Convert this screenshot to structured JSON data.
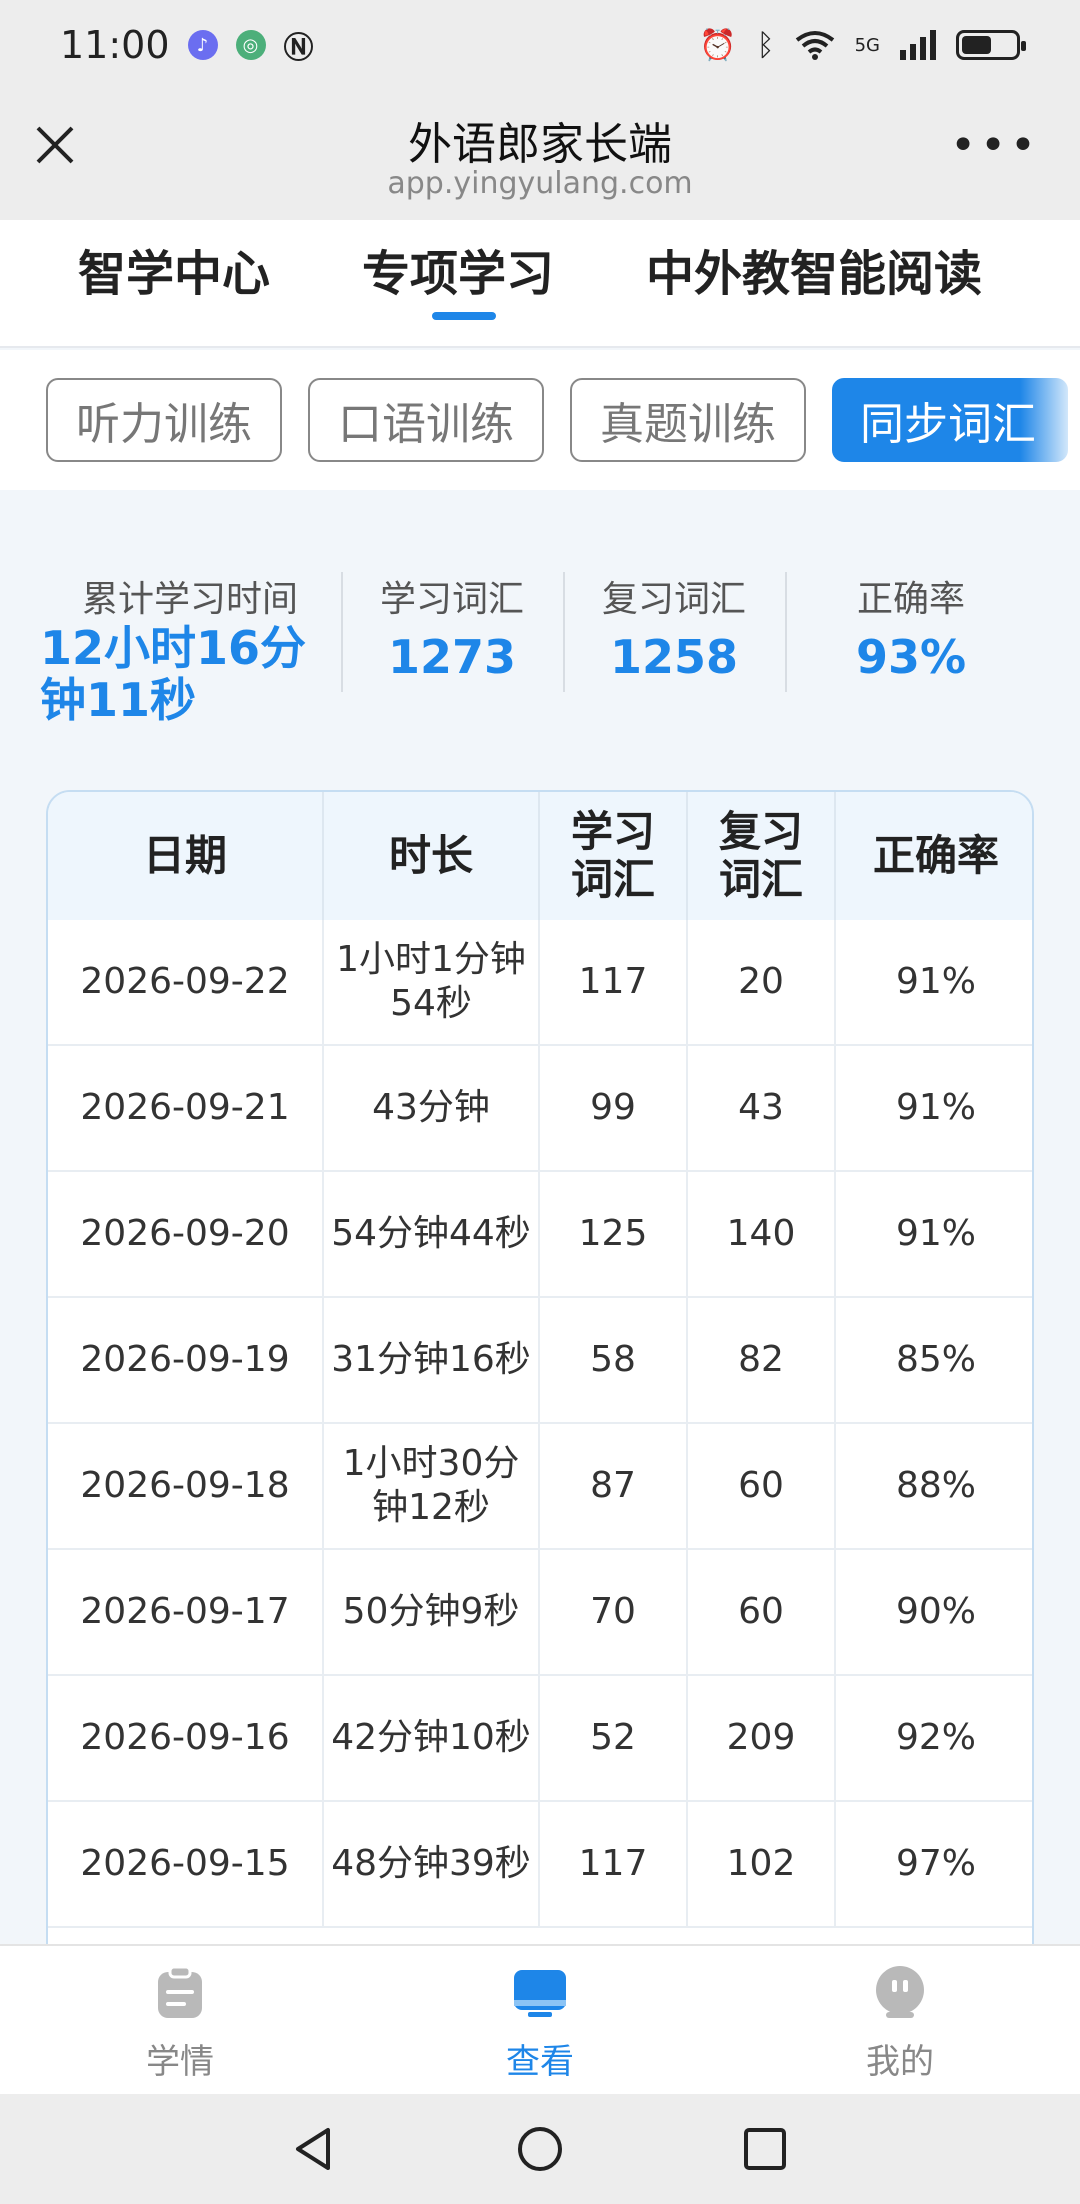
{
  "status_bar": {
    "time": "11:00",
    "network_label": "5G",
    "battery_level": 0.55
  },
  "header": {
    "title": "外语郎家长端",
    "url": "app.yingyulang.com"
  },
  "main_tabs": [
    {
      "label": "智学中心",
      "active": false
    },
    {
      "label": "专项学习",
      "active": true
    },
    {
      "label": "中外教智能阅读",
      "active": false
    }
  ],
  "sub_tabs": [
    {
      "label": "听力训练",
      "active": false
    },
    {
      "label": "口语训练",
      "active": false
    },
    {
      "label": "真题训练",
      "active": false
    },
    {
      "label": "同步词汇",
      "active": true
    }
  ],
  "summary": {
    "total_time_label": "累计学习时间",
    "total_time_value": "12小时16分钟11秒",
    "learned_label": "学习词汇",
    "learned_value": "1273",
    "reviewed_label": "复习词汇",
    "reviewed_value": "1258",
    "accuracy_label": "正确率",
    "accuracy_value": "93%"
  },
  "table": {
    "headers": [
      "日期",
      "时长",
      "学习词汇",
      "复习词汇",
      "正确率"
    ],
    "rows": [
      [
        "2026-09-22",
        "1小时1分钟54秒",
        "117",
        "20",
        "91%"
      ],
      [
        "2026-09-21",
        "43分钟",
        "99",
        "43",
        "91%"
      ],
      [
        "2026-09-20",
        "54分钟44秒",
        "125",
        "140",
        "91%"
      ],
      [
        "2026-09-19",
        "31分钟16秒",
        "58",
        "82",
        "85%"
      ],
      [
        "2026-09-18",
        "1小时30分钟12秒",
        "87",
        "60",
        "88%"
      ],
      [
        "2026-09-17",
        "50分钟9秒",
        "70",
        "60",
        "90%"
      ],
      [
        "2026-09-16",
        "42分钟10秒",
        "52",
        "209",
        "92%"
      ],
      [
        "2026-09-15",
        "48分钟39秒",
        "117",
        "102",
        "97%"
      ]
    ]
  },
  "bottom_nav": [
    {
      "label": "学情",
      "icon": "clipboard-icon",
      "active": false
    },
    {
      "label": "查看",
      "icon": "monitor-icon",
      "active": true
    },
    {
      "label": "我的",
      "icon": "robot-face-icon",
      "active": false
    }
  ],
  "colors": {
    "accent": "#1e86e8",
    "background": "#f2f6fa"
  }
}
